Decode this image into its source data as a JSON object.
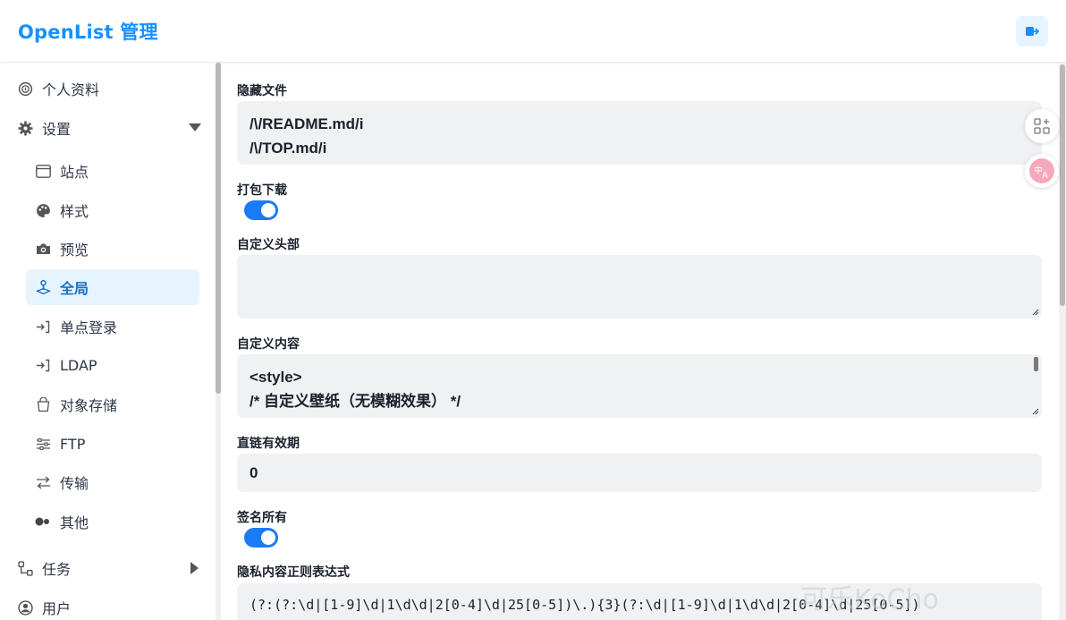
{
  "header": {
    "title": "OpenList 管理"
  },
  "sidebar": {
    "items": [
      {
        "label": "个人资料",
        "icon": "fingerprint-icon"
      },
      {
        "label": "设置",
        "icon": "gear-icon"
      },
      {
        "label": "站点",
        "icon": "browser-window-icon"
      },
      {
        "label": "样式",
        "icon": "palette-icon"
      },
      {
        "label": "预览",
        "icon": "camera-icon"
      },
      {
        "label": "全局",
        "icon": "joystick-icon"
      },
      {
        "label": "单点登录",
        "icon": "login-arrow-icon"
      },
      {
        "label": "LDAP",
        "icon": "login-arrow-icon"
      },
      {
        "label": "对象存储",
        "icon": "bucket-icon"
      },
      {
        "label": "FTP",
        "icon": "server-icon"
      },
      {
        "label": "传输",
        "icon": "transfer-arrows-icon"
      },
      {
        "label": "其他",
        "icon": "toggle-dots-icon"
      },
      {
        "label": "任务",
        "icon": "tasks-icon"
      },
      {
        "label": "用户",
        "icon": "user-circle-icon"
      }
    ]
  },
  "main": {
    "hidden_files": {
      "label": "隐藏文件",
      "lines": [
        "/\\/README.md/i",
        "/\\/TOP.md/i"
      ]
    },
    "package_download": {
      "label": "打包下载",
      "enabled": true
    },
    "custom_head": {
      "label": "自定义头部",
      "value": ""
    },
    "custom_body": {
      "label": "自定义内容",
      "lines": [
        "<style>",
        "/* 自定义壁纸（无模糊效果） */"
      ]
    },
    "link_expiration": {
      "label": "直链有效期",
      "value": "0"
    },
    "sign_all": {
      "label": "签名所有",
      "enabled": true
    },
    "privacy_regex": {
      "label": "隐私内容正则表达式",
      "value": "(?:(?:\\d|[1-9]\\d|1\\d\\d|2[0-4]\\d|25[0-5])\\.){3}(?:\\d|[1-9]\\d|1\\d\\d|2[0-4]\\d|25[0-5])"
    }
  },
  "colors": {
    "accent": "#1890ff",
    "toggle": "#1a7cf5",
    "active_bg": "#e6f4ff"
  },
  "watermark": "可乐KoCho"
}
